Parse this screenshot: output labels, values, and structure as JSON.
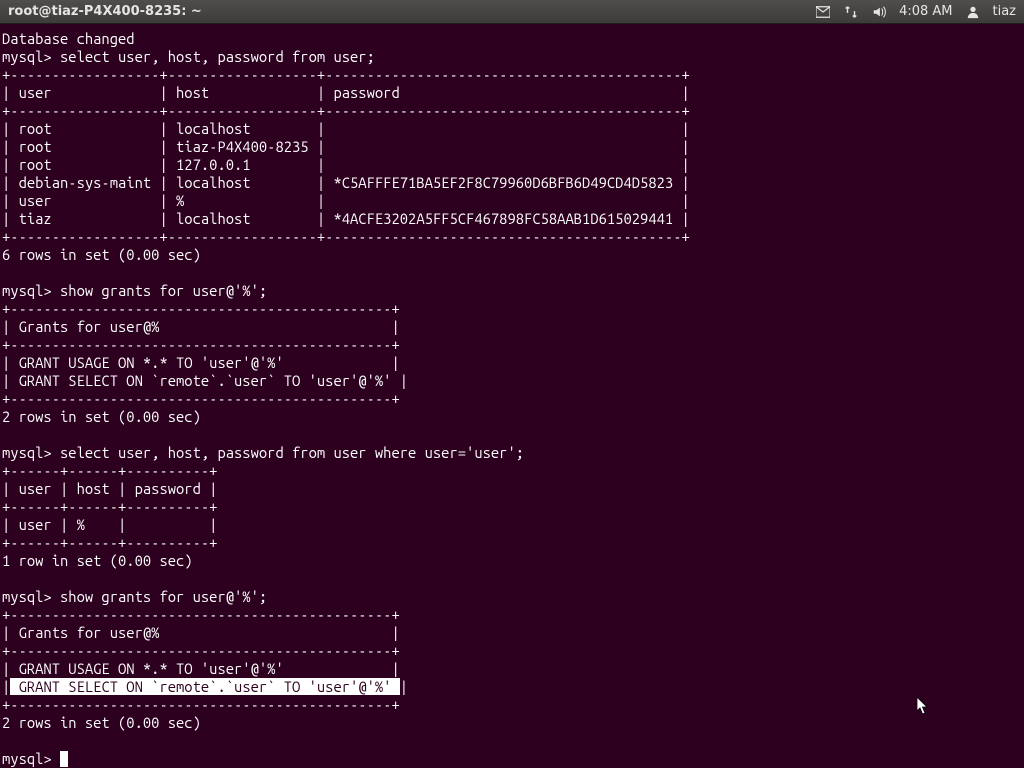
{
  "panel": {
    "title": "root@tiaz-P4X400-8235: ~",
    "time": "4:08 AM",
    "user": "tiaz"
  },
  "term": {
    "line01": "Database changed",
    "line02": "mysql> select user, host, password from user;",
    "line03": "+------------------+------------------+-------------------------------------------+",
    "line04": "| user             | host             | password                                  |",
    "line05": "+------------------+------------------+-------------------------------------------+",
    "line06": "| root             | localhost        |                                           |",
    "line07": "| root             | tiaz-P4X400-8235 |                                           |",
    "line08": "| root             | 127.0.0.1        |                                           |",
    "line09": "| debian-sys-maint | localhost        | *C5AFFFE71BA5EF2F8C79960D6BFB6D49CD4D5823 |",
    "line10": "| user             | %                |                                           |",
    "line11": "| tiaz             | localhost        | *4ACFE3202A5FF5CF467898FC58AAB1D615029441 |",
    "line12": "+------------------+------------------+-------------------------------------------+",
    "line13": "6 rows in set (0.00 sec)",
    "line14": "",
    "line15": "mysql> show grants for user@'%';",
    "line16": "+----------------------------------------------+",
    "line17": "| Grants for user@%                            |",
    "line18": "+----------------------------------------------+",
    "line19": "| GRANT USAGE ON *.* TO 'user'@'%'             |",
    "line20": "| GRANT SELECT ON `remote`.`user` TO 'user'@'%' |",
    "line21": "+----------------------------------------------+",
    "line22": "2 rows in set (0.00 sec)",
    "line23": "",
    "line24": "mysql> select user, host, password from user where user='user';",
    "line25": "+------+------+----------+",
    "line26": "| user | host | password |",
    "line27": "+------+------+----------+",
    "line28": "| user | %    |          |",
    "line29": "+------+------+----------+",
    "line30": "1 row in set (0.00 sec)",
    "line31": "",
    "line32": "mysql> show grants for user@'%';",
    "line33": "+----------------------------------------------+",
    "line34": "| Grants for user@%                            |",
    "line35": "+----------------------------------------------+",
    "line36": "| GRANT USAGE ON *.* TO 'user'@'%'             |",
    "line37a": "|",
    "line37b": " GRANT SELECT ON `remote`.`user` TO 'user'@'%' ",
    "line37c": "|",
    "line38": "+----------------------------------------------+",
    "line39": "2 rows in set (0.00 sec)",
    "line40": "",
    "line41": "mysql> "
  }
}
